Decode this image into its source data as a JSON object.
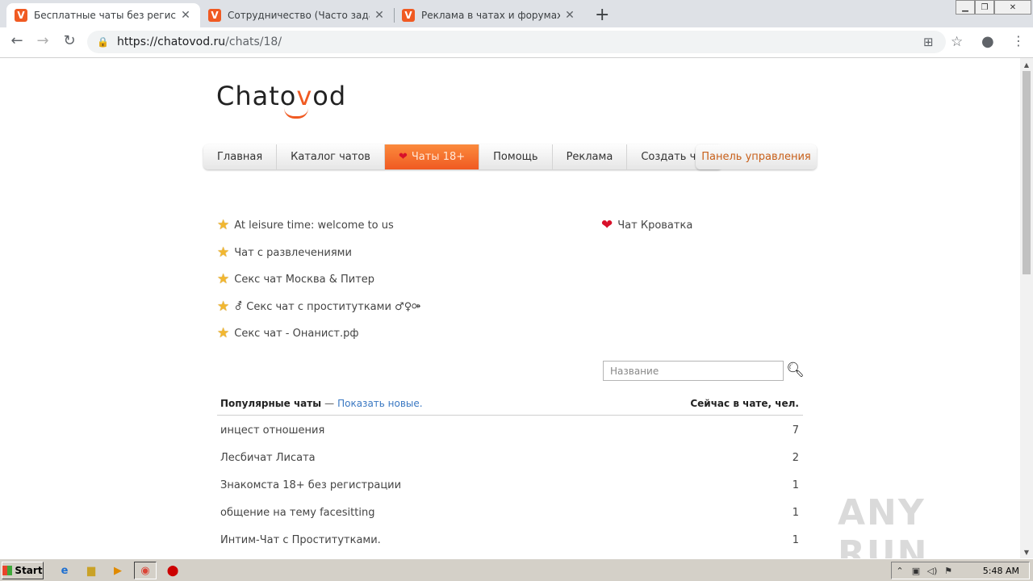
{
  "browser": {
    "tabs": [
      {
        "title": "Бесплатные чаты без регистрации",
        "favicon": "V",
        "active": true
      },
      {
        "title": "Сотрудничество (Часто задаваем",
        "favicon": "V",
        "active": false
      },
      {
        "title": "Реклама в чатах и форумах - Chat",
        "favicon": "V",
        "active": false
      }
    ],
    "new_tab": "+",
    "url_domain": "https://chatovod.ru",
    "url_path": "/chats/18/"
  },
  "site": {
    "logo_prefix": "Chato",
    "logo_v": "v",
    "logo_suffix": "od",
    "menu": [
      {
        "label": "Главная",
        "active": false
      },
      {
        "label": "Каталог чатов",
        "active": false
      },
      {
        "label": "Чаты 18+",
        "active": true
      },
      {
        "label": "Помощь",
        "active": false
      },
      {
        "label": "Реклама",
        "active": false
      },
      {
        "label": "Создать чат",
        "active": false
      }
    ],
    "panel_label": "Панель управления",
    "featured_left": [
      "At leisure time: welcome to us",
      "Чат с развлечениями",
      "Секс чат Москва & Питер",
      "⚦ Секс чат с проститутками ♂♀⚩",
      "Секс чат - Онанист.рф"
    ],
    "featured_right": [
      "Чат Кроватка"
    ],
    "search": {
      "placeholder": "Название"
    },
    "table": {
      "popular_label": "Популярные чаты",
      "dash": "—",
      "show_new_label": "Показать новые.",
      "now_label": "Сейчас в чате, чел.",
      "rows": [
        {
          "name": "инцест отношения",
          "count": "7"
        },
        {
          "name": "Лесбичат Лисата",
          "count": "2"
        },
        {
          "name": "Знакомста 18+ без регистрации",
          "count": "1"
        },
        {
          "name": "общение на тему facesitting",
          "count": "1"
        },
        {
          "name": "Интим-Чат с Проститутками.",
          "count": "1"
        }
      ]
    },
    "watermark": "ANY RUN"
  },
  "taskbar": {
    "start_label": "Start",
    "clock": "5:48 AM"
  },
  "colors": {
    "accent": "#f05a22",
    "link": "#3a78c2",
    "heart": "#d8102a",
    "star": "#f2b730"
  }
}
